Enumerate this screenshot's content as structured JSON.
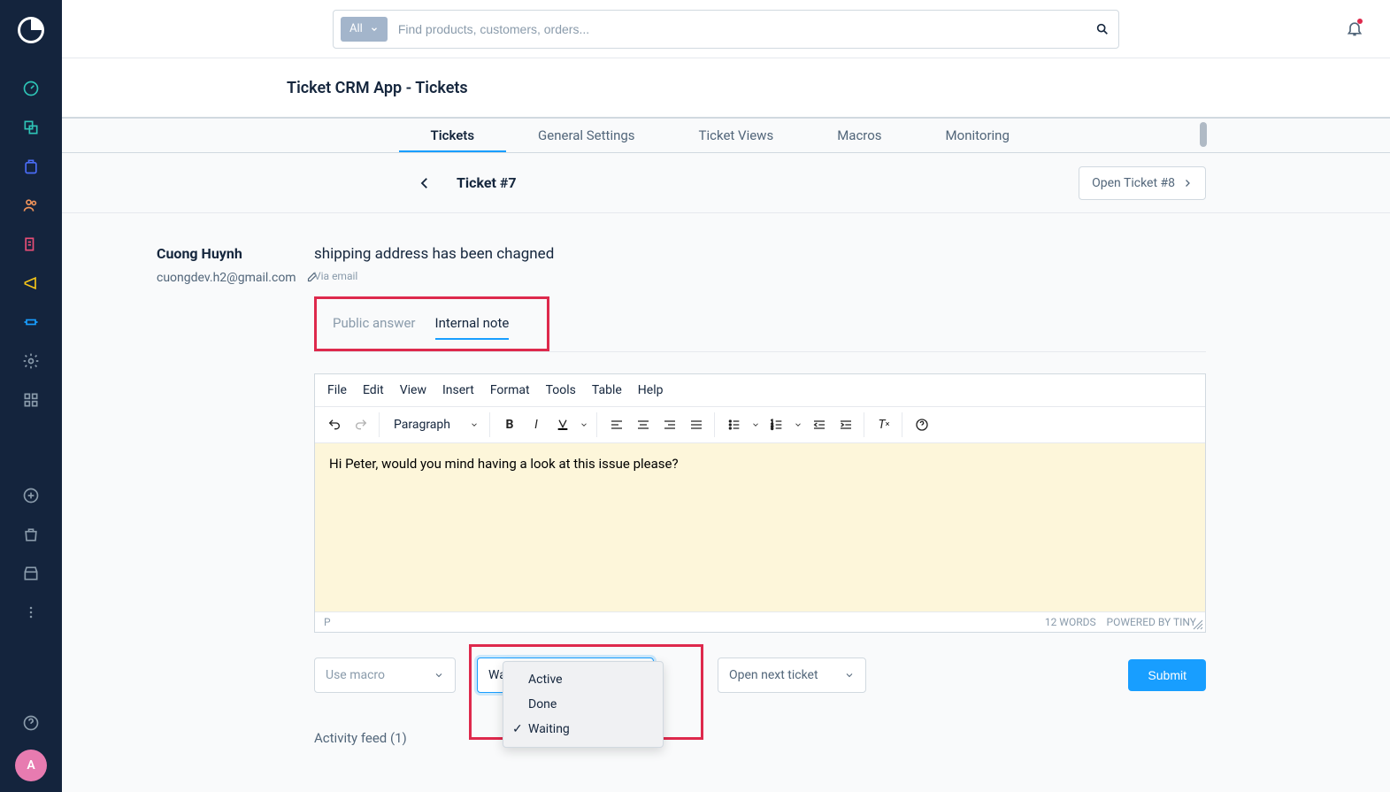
{
  "sidebar": {
    "avatar_initial": "A"
  },
  "search": {
    "filter_label": "All",
    "placeholder": "Find products, customers, orders..."
  },
  "page": {
    "title": "Ticket CRM App - Tickets"
  },
  "tabs": [
    "Tickets",
    "General Settings",
    "Ticket Views",
    "Macros",
    "Monitoring"
  ],
  "ticket_header": {
    "title": "Ticket #7",
    "open_next": "Open Ticket #8"
  },
  "customer": {
    "name": "Cuong Huynh",
    "email": "cuongdev.h2@gmail.com"
  },
  "ticket": {
    "subject": "shipping address has been chagned",
    "via": "Via email"
  },
  "reply_tabs": {
    "public": "Public answer",
    "internal": "Internal note"
  },
  "editor": {
    "menus": [
      "File",
      "Edit",
      "View",
      "Insert",
      "Format",
      "Tools",
      "Table",
      "Help"
    ],
    "block_label": "Paragraph",
    "content": "Hi Peter, would you mind having a look at this issue please?",
    "status_path": "P",
    "words": "12 WORDS",
    "powered": "POWERED BY TINY"
  },
  "actions": {
    "macro_placeholder": "Use macro",
    "status_value": "Waiting",
    "next_action": "Open next ticket",
    "submit": "Submit"
  },
  "status_dropdown": [
    "Active",
    "Done",
    "Waiting"
  ],
  "activity_title": "Activity feed (1)"
}
